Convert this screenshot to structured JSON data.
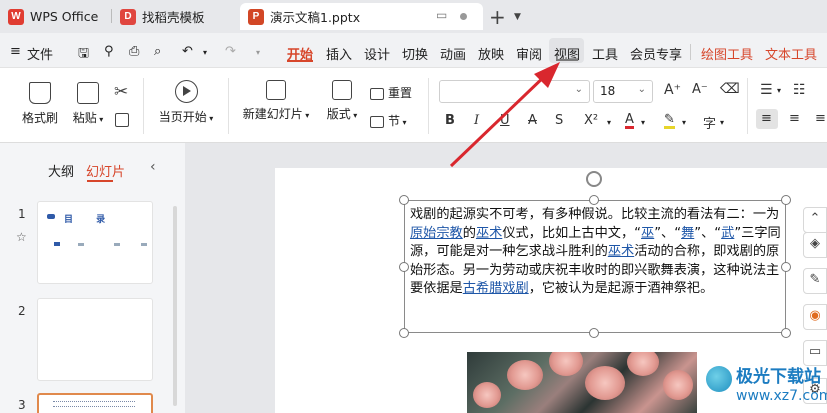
{
  "tabs": {
    "wps": "WPS Office",
    "template": "找稻壳模板",
    "document": "演示文稿1.pptx"
  },
  "menu": {
    "file": "文件",
    "items": [
      "开始",
      "插入",
      "设计",
      "切换",
      "动画",
      "放映",
      "审阅",
      "视图",
      "工具",
      "会员专享"
    ],
    "contextual": [
      "绘图工具",
      "文本工具"
    ]
  },
  "ribbon": {
    "format_painter": "格式刷",
    "paste": "粘贴",
    "play_from_current": "当页开始",
    "new_slide": "新建幻灯片",
    "layout": "版式",
    "reset": "重置",
    "section": "节",
    "font_name": "",
    "font_size": "18"
  },
  "panel": {
    "outline_tab": "大纲",
    "slides_tab": "幻灯片",
    "slide_numbers": [
      "1",
      "2",
      "3"
    ],
    "thumb1_title": "目 录"
  },
  "slide_text": {
    "p1": "戏剧的起源实不可考，有多种假说。比较主流的看法有二：一为",
    "l1": "原始宗教",
    "p2": "的",
    "l2": "巫术",
    "p3": "仪式，比如上古中文，“",
    "l3": "巫",
    "p4": "”、“",
    "l4": "舞",
    "p5": "”、“",
    "l5": "武",
    "p6": "”三字同源，可能是对一种乞求战斗胜利的",
    "l6": "巫术",
    "p7": "活动的合称，即戏剧的原始形态。另一为劳动或庆祝丰收时的即兴歌舞表演，这种说法主要依据是",
    "l7": "古希腊戏剧",
    "p8": "，它被认为是起源于酒神祭祀。"
  },
  "watermark": {
    "line1": "极光下载站",
    "line2": "www.xz7.com"
  },
  "colors": {
    "accent": "#d7462b",
    "link": "#1f57a8",
    "arrow": "#d9272e"
  }
}
